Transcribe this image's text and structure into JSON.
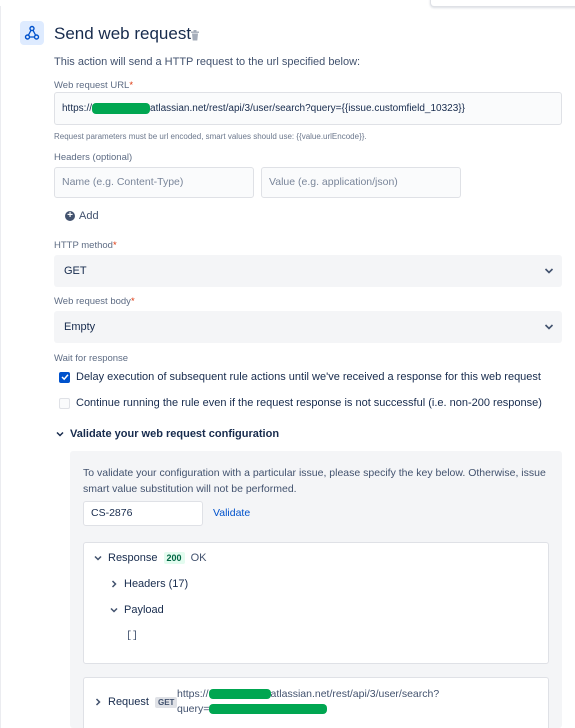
{
  "header": {
    "title": "Send web request",
    "description": "This action will send a HTTP request to the url specified below:"
  },
  "url_field": {
    "label": "Web request URL",
    "required_mark": "*",
    "value_prefix": "https://",
    "value_suffix": "atlassian.net/rest/api/3/user/search?query={{issue.customfield_10323}}",
    "hint": "Request parameters must be url encoded, smart values should use: {{value.urlEncode}}."
  },
  "headers": {
    "label": "Headers (optional)",
    "name_placeholder": "Name (e.g. Content-Type)",
    "value_placeholder": "Value (e.g. application/json)",
    "add_label": "Add"
  },
  "http_method": {
    "label": "HTTP method",
    "required_mark": "*",
    "value": "GET"
  },
  "body": {
    "label": "Web request body",
    "required_mark": "*",
    "value": "Empty"
  },
  "wait": {
    "label": "Wait for response",
    "delay_label": "Delay execution of subsequent rule actions until we've received a response for this web request",
    "delay_checked": true,
    "continue_label": "Continue running the rule even if the request response is not successful (i.e. non-200 response)",
    "continue_checked": false
  },
  "validate": {
    "section_title": "Validate your web request configuration",
    "text": "To validate your configuration with a particular issue, please specify the key below. Otherwise, issue smart value substitution will not be performed.",
    "issue_key": "CS-2876",
    "validate_label": "Validate"
  },
  "response": {
    "label": "Response",
    "status_code": "200",
    "status_text": "OK",
    "headers_label": "Headers (17)",
    "payload_label": "Payload",
    "payload_value": "[]"
  },
  "request": {
    "label": "Request",
    "method": "GET",
    "url_line1_prefix": "https://",
    "url_line1_suffix": "atlassian.net/rest/api/3/user/search?",
    "url_line2_prefix": "query="
  },
  "colors": {
    "accent": "#0052cc",
    "redaction": "#00a651",
    "success": "#006644"
  },
  "icons": [
    "webhook-icon",
    "trash-icon",
    "plus-icon",
    "chevron-down-icon",
    "chevron-right-icon",
    "check-icon"
  ]
}
